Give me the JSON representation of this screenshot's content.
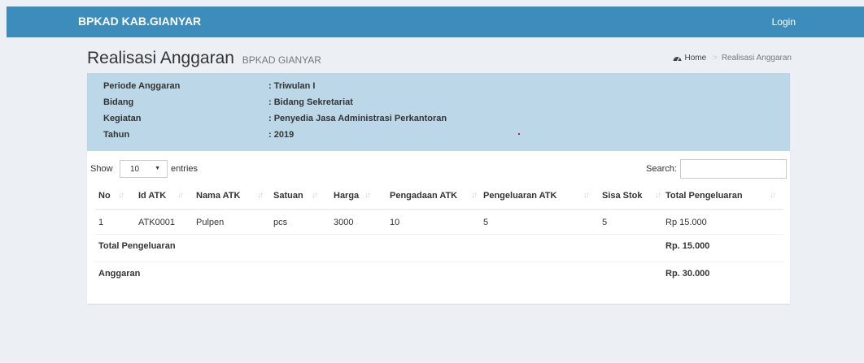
{
  "navbar": {
    "brand": "BPKAD KAB.GIANYAR",
    "login": "Login"
  },
  "header": {
    "title": "Realisasi Anggaran",
    "subtitle": "BPKAD GIANYAR",
    "breadcrumb": {
      "home": "Home",
      "current": "Realisasi Anggaran",
      "home_icon": "dashboard-icon"
    }
  },
  "info": {
    "rows": [
      {
        "label": "Periode Anggaran",
        "value": ": Triwulan I"
      },
      {
        "label": "Bidang",
        "value": ": Bidang Sekretariat"
      },
      {
        "label": "Kegiatan",
        "value": ": Penyedia Jasa Administrasi Perkantoran"
      },
      {
        "label": "Tahun",
        "value": ": 2019"
      }
    ]
  },
  "table_controls": {
    "show_label": "Show",
    "entries_value": "10",
    "entries_label": "entries",
    "search_label": "Search:",
    "search_value": ""
  },
  "table": {
    "columns": [
      "No",
      "Id ATK",
      "Nama ATK",
      "Satuan",
      "Harga",
      "Pengadaan ATK",
      "Pengeluaran ATK",
      "Sisa Stok",
      "Total Pengeluaran"
    ],
    "rows": [
      [
        "1",
        "ATK0001",
        "Pulpen",
        "pcs",
        "3000",
        "10",
        "5",
        "5",
        "Rp 15.000"
      ]
    ],
    "footer": [
      {
        "label": "Total Pengeluaran",
        "value": "Rp. 15.000"
      },
      {
        "label": "Anggaran",
        "value": "Rp. 30.000"
      }
    ]
  },
  "colors": {
    "navbar": "#3c8dbc",
    "info_panel": "#bcd8e8",
    "background": "#ecf0f5"
  }
}
